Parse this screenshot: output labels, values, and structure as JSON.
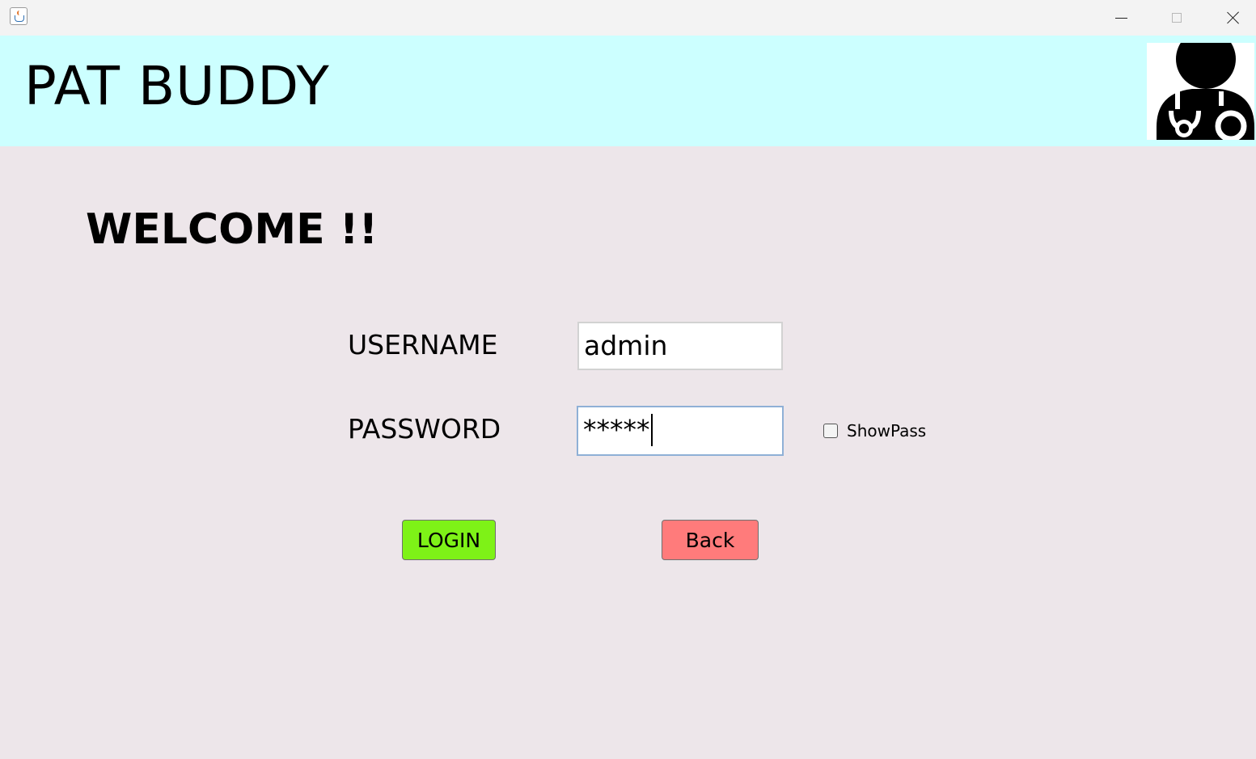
{
  "window": {
    "controls": {
      "minimize": "minimize-icon",
      "maximize": "maximize-icon",
      "close": "close-icon"
    },
    "app_icon": "java-cup-icon"
  },
  "header": {
    "title": "PAT BUDDY",
    "background": "#ccffff",
    "logo": "doctor-stethoscope-icon"
  },
  "main": {
    "welcome": "WELCOME !!",
    "background": "#ede6ea"
  },
  "form": {
    "username_label": "USERNAME",
    "username_value": "admin",
    "password_label": "PASSWORD",
    "password_value": "*****",
    "showpass_label": "ShowPass",
    "showpass_checked": false
  },
  "buttons": {
    "login_label": "LOGIN",
    "login_color": "#7ef217",
    "back_label": "Back",
    "back_color": "#ff7b7b"
  }
}
